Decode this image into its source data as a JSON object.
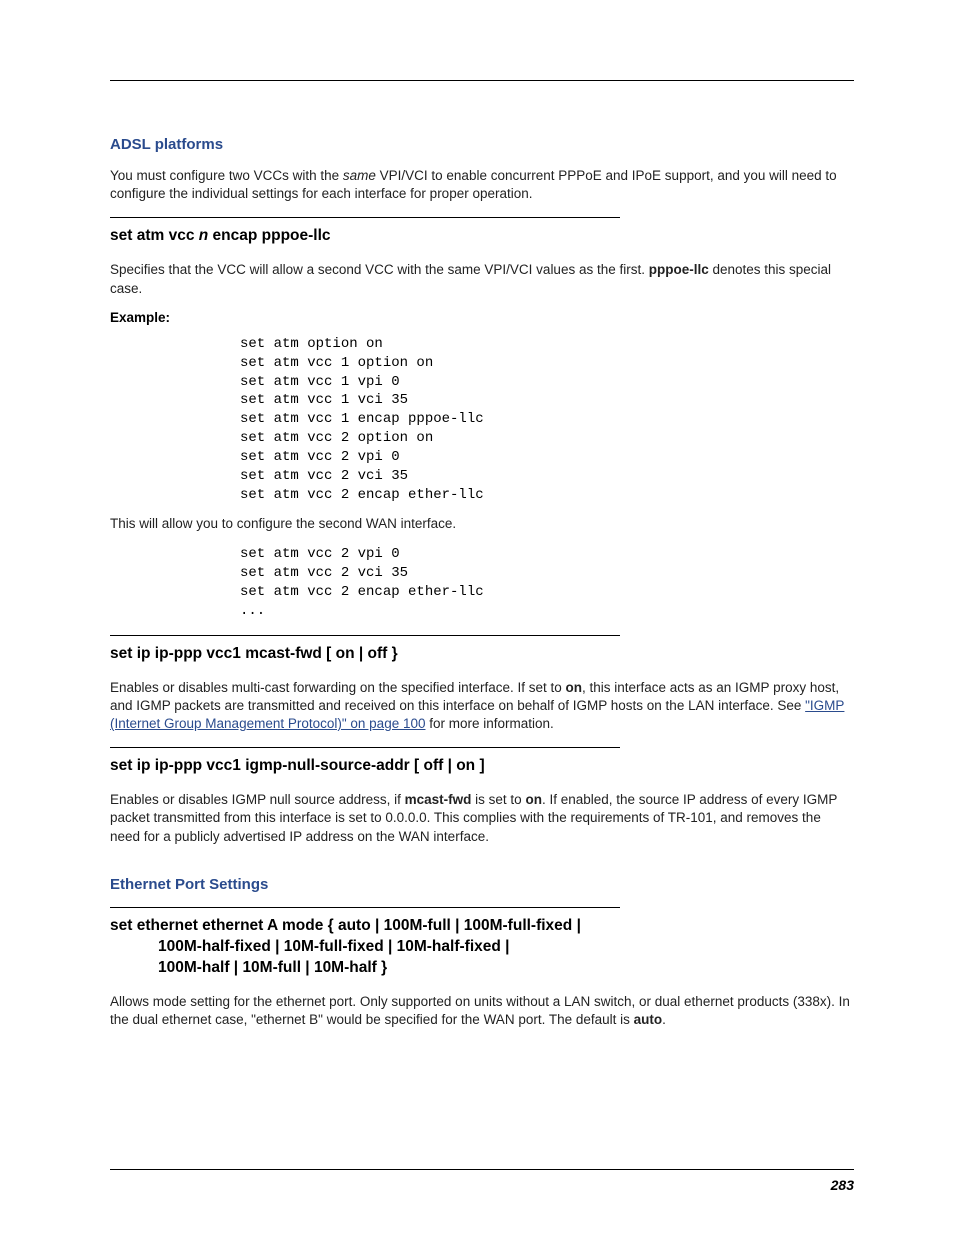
{
  "sections": {
    "adsl": {
      "title": "ADSL platforms",
      "intro_pre": "You must configure two VCCs with the ",
      "intro_same": "same",
      "intro_post": " VPI/VCI to enable concurrent PPPoE and IPoE support, and you will need to configure the individual settings for each interface for proper operation."
    },
    "set_atm": {
      "heading_pre": "set atm vcc ",
      "heading_n": "n",
      "heading_post": " encap pppoe-llc",
      "desc_pre": "Specifies that the VCC will allow a second VCC with the same VPI/VCI values as the first. ",
      "desc_bold": "pppoe-llc",
      "desc_post": " denotes this special case.",
      "example_label": "Example:",
      "code1": "set atm option on\nset atm vcc 1 option on\nset atm vcc 1 vpi 0\nset atm vcc 1 vci 35\nset atm vcc 1 encap pppoe-llc\nset atm vcc 2 option on\nset atm vcc 2 vpi 0\nset atm vcc 2 vci 35\nset atm vcc 2 encap ether-llc",
      "bridge": "This will allow you to configure the second WAN interface.",
      "code2": "set atm vcc 2 vpi 0\nset atm vcc 2 vci 35\nset atm vcc 2 encap ether-llc\n..."
    },
    "mcast": {
      "heading": "set ip ip-ppp vcc1 mcast-fwd [ on | off }",
      "desc_pre": "Enables or disables multi-cast forwarding on the specified interface. If set to ",
      "desc_on": "on",
      "desc_mid": ", this interface acts as an IGMP proxy host, and IGMP packets are transmitted and received on this interface on behalf of IGMP hosts on the LAN interface. See ",
      "link": "\"IGMP (Internet Group Management Protocol)\" on page 100",
      "desc_post": " for more information."
    },
    "igmp_null": {
      "heading": "set ip ip-ppp vcc1 igmp-null-source-addr [ off | on ]",
      "desc_pre": "Enables or disables IGMP null source address, if ",
      "desc_bold1": "mcast-fwd",
      "desc_mid1": " is set to ",
      "desc_bold2": "on",
      "desc_post": ". If enabled, the source IP address of every IGMP packet transmitted from this interface is set to 0.0.0.0. This complies with the requirements of TR-101, and removes the need for a publicly advertised IP address on the WAN interface."
    },
    "eth": {
      "title": "Ethernet Port Settings",
      "heading_l1": "set ethernet ethernet A mode { auto | 100M-full | 100M-full-fixed |",
      "heading_l2": "100M-half-fixed | 10M-full-fixed | 10M-half-fixed |",
      "heading_l3": "100M-half | 10M-full | 10M-half }",
      "desc_pre": "Allows mode setting for the ethernet port. Only supported on units without a LAN switch, or dual ethernet products (338x). In the dual ethernet case, \"ethernet B\" would be specified for the WAN port. The default is ",
      "desc_bold": "auto",
      "desc_post": "."
    }
  },
  "page_number": "283"
}
